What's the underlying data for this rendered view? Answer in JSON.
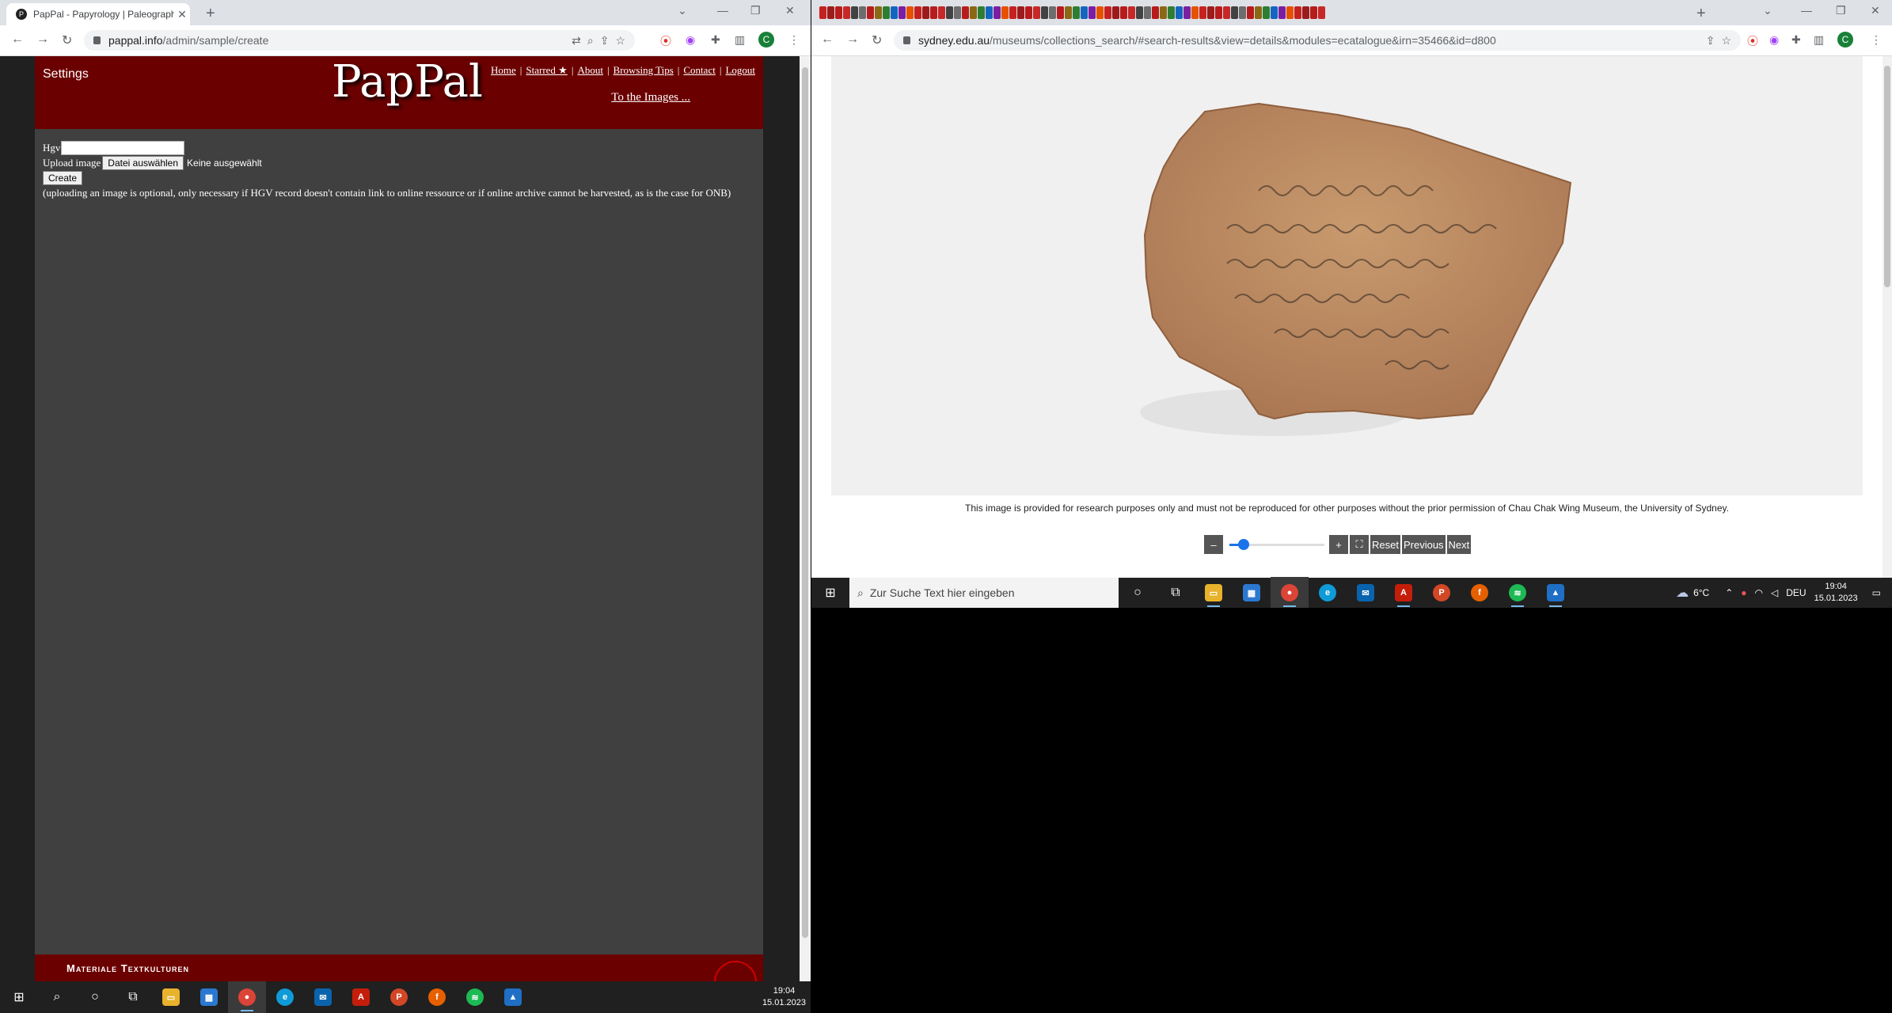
{
  "left_browser": {
    "tab_title": "PapPal - Papyrology | Paleograph",
    "url_host": "pappal.info",
    "url_path": "/admin/sample/create",
    "profile_letter": "C"
  },
  "pappal": {
    "settings": "Settings",
    "logo": "PapPal",
    "menu": [
      "Home",
      "Starred ★",
      "About",
      "Browsing Tips",
      "Contact",
      "Logout"
    ],
    "to_images": "To the Images ...",
    "form": {
      "hgv_label": "Hgv",
      "hgv_value": "",
      "upload_label": "Upload image",
      "file_button": "Datei auswählen",
      "file_status": "Keine ausgewählt",
      "create_button": "Create",
      "note": "(uploading an image is optional, only necessary if HGV record doesn't contain link to online ressource or if online archive cannot be harvested, as is the case for ONB)"
    },
    "footer_text": "Materiale Textkulturen"
  },
  "right_browser": {
    "url_host": "sydney.edu.au",
    "url_path": "/museums/collections_search/#search-results&view=details&modules=ecatalogue&irn=35466&id=d800",
    "profile_letter": "C",
    "caption": "This image is provided for research purposes only and must not be reproduced for other purposes without the prior permission of Chau Chak Wing Museum, the University of Sydney.",
    "controls": {
      "minus": "–",
      "plus": "+",
      "fullscreen": "⛶",
      "reset": "Reset",
      "previous": "Previous",
      "next": "Next"
    },
    "zoom_level": 0.1
  },
  "taskbar_left": {
    "time": "19:04",
    "date": "15.01.2023"
  },
  "taskbar_right": {
    "search_placeholder": "Zur Suche Text hier eingeben",
    "weather": "6°C",
    "language": "DEU",
    "time": "19:04",
    "date": "15.01.2023"
  },
  "colors": {
    "header_red": "#6b0000",
    "page_gray": "#404040",
    "accent_blue": "#1a73e8"
  }
}
